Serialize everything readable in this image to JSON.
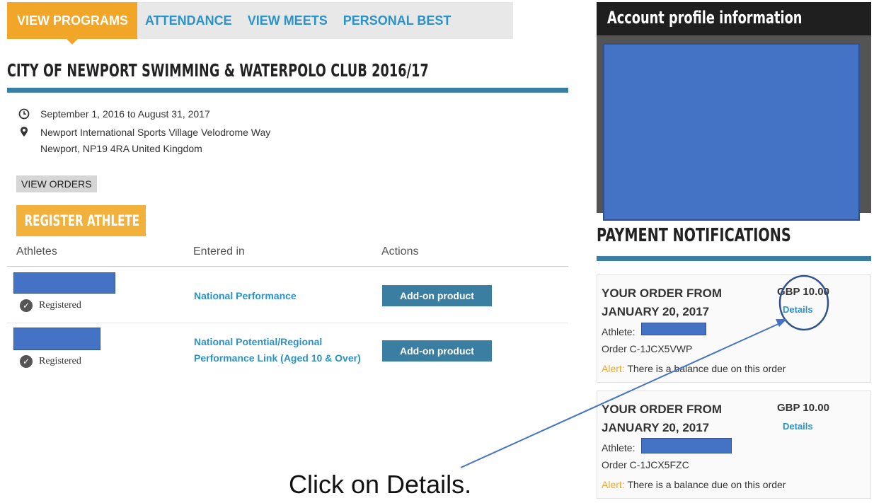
{
  "tabs": [
    {
      "label": "VIEW PROGRAMS",
      "active": true
    },
    {
      "label": "ATTENDANCE"
    },
    {
      "label": "VIEW MEETS"
    },
    {
      "label": "PERSONAL BEST"
    }
  ],
  "program": {
    "title": "CITY OF NEWPORT SWIMMING & WATERPOLO CLUB 2016/17",
    "dates": "September 1, 2016 to August 31, 2017",
    "address_line1": "Newport International Sports Village Velodrome Way",
    "address_line2": "Newport, NP19 4RA United Kingdom"
  },
  "buttons": {
    "view_orders": "VIEW ORDERS",
    "register_athlete": "REGISTER ATHLETE"
  },
  "table": {
    "headers": [
      "Athletes",
      "Entered in",
      "Actions"
    ],
    "rows": [
      {
        "status": "Registered",
        "entered_in": "National Performance",
        "action": "Add-on product"
      },
      {
        "status": "Registered",
        "entered_in_line1": "National Potential/Regional",
        "entered_in_line2": "Performance Link (Aged 10 & Over)",
        "action": "Add-on product"
      }
    ]
  },
  "profile": {
    "title": "Account profile information"
  },
  "payments": {
    "title": "PAYMENT NOTIFICATIONS",
    "cards": [
      {
        "order_line1": "YOUR ORDER FROM",
        "order_line2": "JANUARY 20, 2017",
        "amount": "GBP 10.00",
        "details": "Details",
        "athlete_label": "Athlete:",
        "order_no": "Order C-1JCX5VWP",
        "alert_label": "Alert:",
        "alert_text": " There is a balance due on this order"
      },
      {
        "order_line1": "YOUR ORDER FROM",
        "order_line2": "JANUARY 20, 2017",
        "amount": "GBP 10.00",
        "details": "Details",
        "athlete_label": "Athlete:",
        "order_no": "Order C-1JCX5FZC",
        "alert_label": "Alert:",
        "alert_text": " There is a balance due on this order"
      }
    ]
  },
  "annotation": {
    "text": "Click on Details."
  },
  "colors": {
    "accent_orange": "#f2a628",
    "link_blue": "#2b92c7",
    "rule_blue": "#3a7ea1",
    "redaction_blue": "#4472c4"
  }
}
